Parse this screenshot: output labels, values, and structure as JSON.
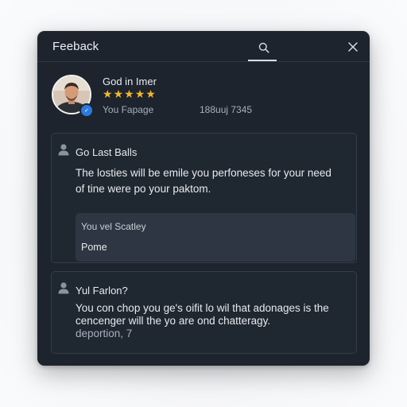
{
  "header": {
    "title": "Feeback",
    "search_icon": "search-icon",
    "close_icon": "close-icon"
  },
  "profile": {
    "name": "God in Imer",
    "rating": 5,
    "stars": [
      "★",
      "★",
      "★",
      "★",
      "★"
    ],
    "meta_left": "You Fapage",
    "meta_right": "188uuj 7345",
    "badge_text": "✓"
  },
  "cards": [
    {
      "title": "Go Last Balls",
      "body_line1": "The losties will be emile you perfoneses for your need",
      "body_line2": "of tine were po your paktom.",
      "reply_label": "You vel Scatley",
      "reply_value": "Pome"
    },
    {
      "title": "Yul Farlon?",
      "body_line1": "You con chop you ge's oifit lo wil that adonages is the",
      "body_line2": "cencenger will the yo are ond chatteragy.",
      "body_line3": "deportion, 7"
    }
  ],
  "colors": {
    "panel": "#1d242d",
    "star": "#f3b72b",
    "accent_badge": "#2a7bde"
  }
}
